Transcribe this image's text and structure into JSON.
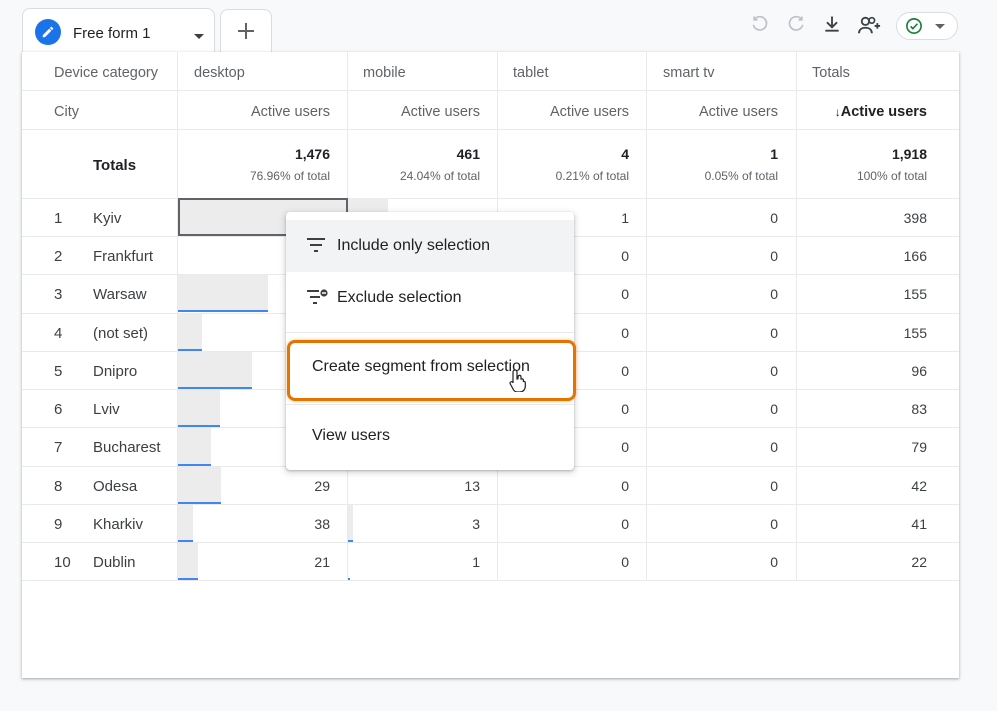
{
  "tab": {
    "title": "Free form 1"
  },
  "toolbar": {
    "undo": "undo-icon",
    "redo": "redo-icon",
    "download": "download-icon",
    "share": "share-user-icon",
    "status": "check-circle-icon"
  },
  "table": {
    "dim_header": "Device category",
    "row_dim_header": "City",
    "columns": [
      {
        "name": "desktop",
        "metric": "Active users",
        "total": "1,476",
        "pct": "76.96% of total"
      },
      {
        "name": "mobile",
        "metric": "Active users",
        "total": "461",
        "pct": "24.04% of total"
      },
      {
        "name": "tablet",
        "metric": "Active users",
        "total": "4",
        "pct": "0.21% of total"
      },
      {
        "name": "smart tv",
        "metric": "Active users",
        "total": "1",
        "pct": "0.05% of total"
      },
      {
        "name": "Totals",
        "metric": "Active users",
        "total": "1,918",
        "pct": "100% of total"
      }
    ],
    "totals_label": "Totals",
    "rows": [
      {
        "idx": "1",
        "city": "Kyiv",
        "desktop": "",
        "mobile": "",
        "tablet": "1",
        "smarttv": "0",
        "total": "398"
      },
      {
        "idx": "2",
        "city": "Frankfurt",
        "desktop": "",
        "mobile": "",
        "tablet": "0",
        "smarttv": "0",
        "total": "166"
      },
      {
        "idx": "3",
        "city": "Warsaw",
        "desktop": "",
        "mobile": "",
        "tablet": "0",
        "smarttv": "0",
        "total": "155"
      },
      {
        "idx": "4",
        "city": "(not set)",
        "desktop": "",
        "mobile": "",
        "tablet": "0",
        "smarttv": "0",
        "total": "155"
      },
      {
        "idx": "5",
        "city": "Dnipro",
        "desktop": "",
        "mobile": "",
        "tablet": "0",
        "smarttv": "0",
        "total": "96"
      },
      {
        "idx": "6",
        "city": "Lviv",
        "desktop": "",
        "mobile": "",
        "tablet": "0",
        "smarttv": "0",
        "total": "83"
      },
      {
        "idx": "7",
        "city": "Bucharest",
        "desktop": "",
        "mobile": "",
        "tablet": "0",
        "smarttv": "0",
        "total": "79"
      },
      {
        "idx": "8",
        "city": "Odesa",
        "desktop": "29",
        "mobile": "13",
        "tablet": "0",
        "smarttv": "0",
        "total": "42"
      },
      {
        "idx": "9",
        "city": "Kharkiv",
        "desktop": "38",
        "mobile": "3",
        "tablet": "0",
        "smarttv": "0",
        "total": "41"
      },
      {
        "idx": "10",
        "city": "Dublin",
        "desktop": "21",
        "mobile": "1",
        "tablet": "0",
        "smarttv": "0",
        "total": "22"
      }
    ]
  },
  "menu": {
    "include": "Include only selection",
    "exclude": "Exclude selection",
    "create_segment": "Create segment from selection",
    "view_users": "View users"
  },
  "colors": {
    "accent": "#1a73e8",
    "highlight": "#e37400",
    "status_ok": "#188038"
  }
}
